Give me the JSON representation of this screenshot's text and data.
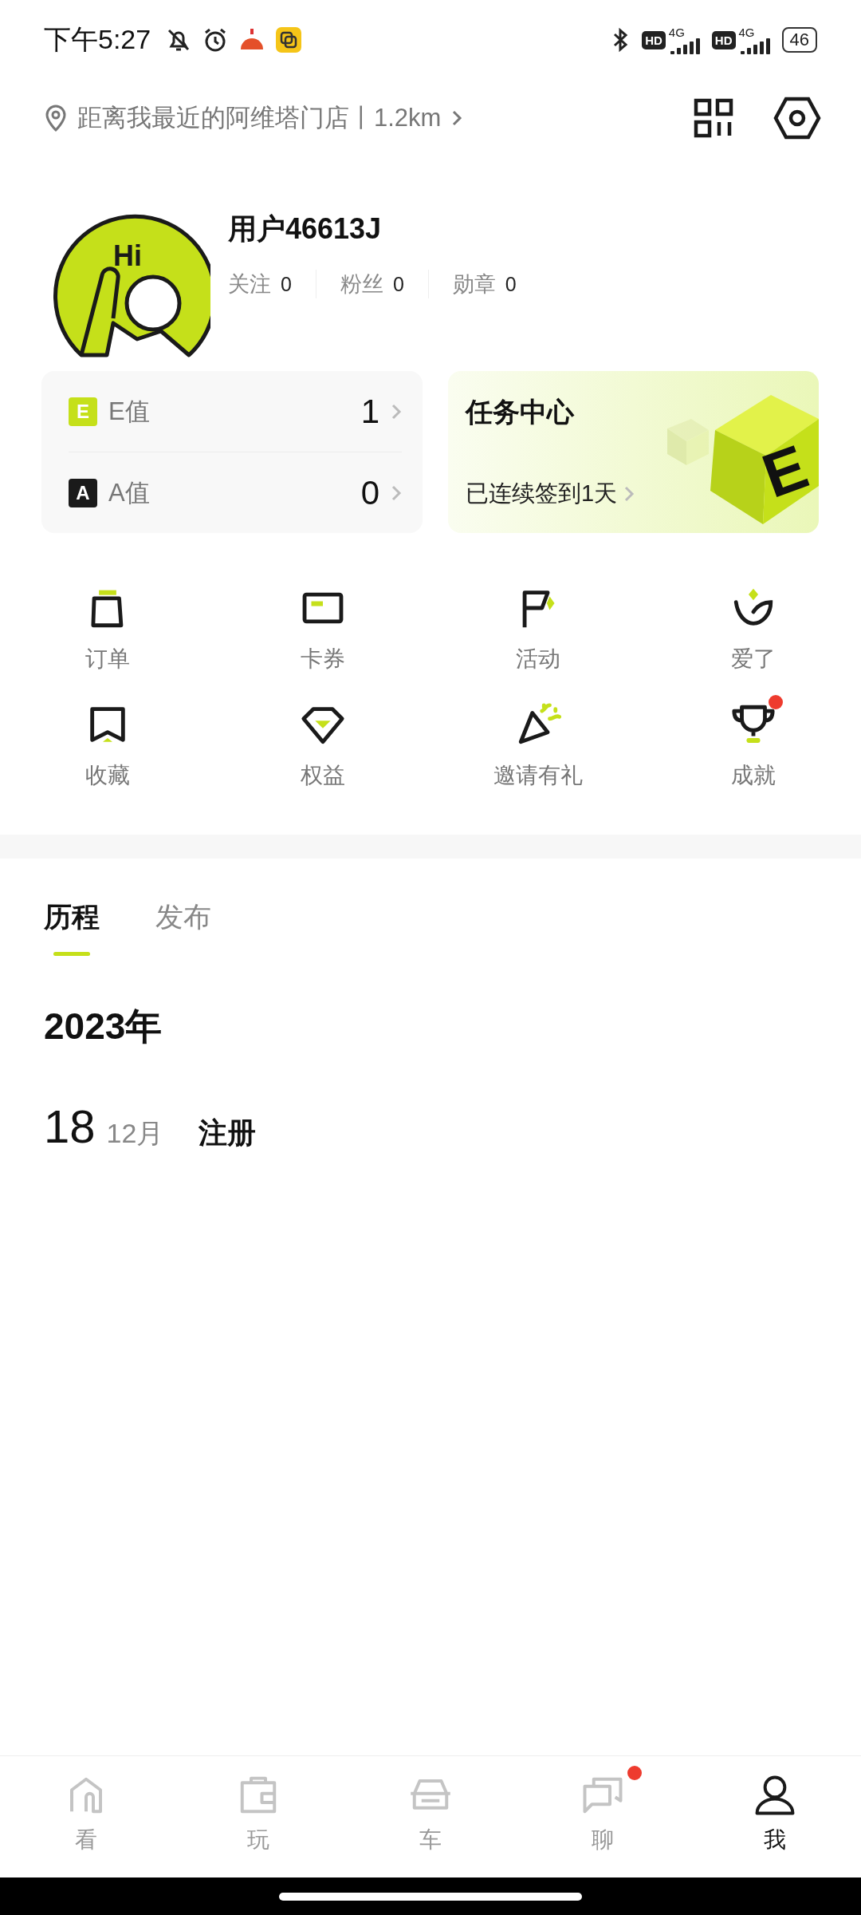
{
  "status_bar": {
    "time": "下午5:27",
    "networks": [
      {
        "hd": "HD",
        "type": "4G"
      },
      {
        "hd": "HD",
        "type": "4G"
      }
    ],
    "battery": "46"
  },
  "location": {
    "text": "距离我最近的阿维塔门店丨1.2km"
  },
  "profile": {
    "avatar_text": "Hi",
    "username": "用户46613J",
    "stats": [
      {
        "label": "关注",
        "value": "0"
      },
      {
        "label": "粉丝",
        "value": "0"
      },
      {
        "label": "勋章",
        "value": "0"
      }
    ]
  },
  "points": [
    {
      "badge": "E",
      "label": "E值",
      "value": "1",
      "color": "#c5e01a"
    },
    {
      "badge": "A",
      "label": "A值",
      "value": "0",
      "color": "#1a1a1a"
    }
  ],
  "task_center": {
    "title": "任务中心",
    "subtitle": "已连续签到1天",
    "cube_letter": "E"
  },
  "shortcuts": [
    {
      "kind": "order",
      "label": "订单",
      "badge": false
    },
    {
      "kind": "coupon",
      "label": "卡券",
      "badge": false
    },
    {
      "kind": "event",
      "label": "活动",
      "badge": false
    },
    {
      "kind": "love",
      "label": "爱了",
      "badge": false
    },
    {
      "kind": "favorite",
      "label": "收藏",
      "badge": false
    },
    {
      "kind": "benefit",
      "label": "权益",
      "badge": false
    },
    {
      "kind": "invite",
      "label": "邀请有礼",
      "badge": false
    },
    {
      "kind": "trophy",
      "label": "成就",
      "badge": true
    }
  ],
  "tabs": [
    {
      "label": "历程",
      "selected": true
    },
    {
      "label": "发布",
      "selected": false
    }
  ],
  "timeline": {
    "year": "2023年",
    "entries": [
      {
        "day": "18",
        "month": "12月",
        "event": "注册"
      }
    ]
  },
  "bottom_nav": [
    {
      "kind": "home",
      "label": "看",
      "selected": false,
      "badge": false
    },
    {
      "kind": "bag",
      "label": "玩",
      "selected": false,
      "badge": false
    },
    {
      "kind": "car",
      "label": "车",
      "selected": false,
      "badge": false
    },
    {
      "kind": "chat",
      "label": "聊",
      "selected": false,
      "badge": true
    },
    {
      "kind": "person",
      "label": "我",
      "selected": true,
      "badge": false
    }
  ]
}
